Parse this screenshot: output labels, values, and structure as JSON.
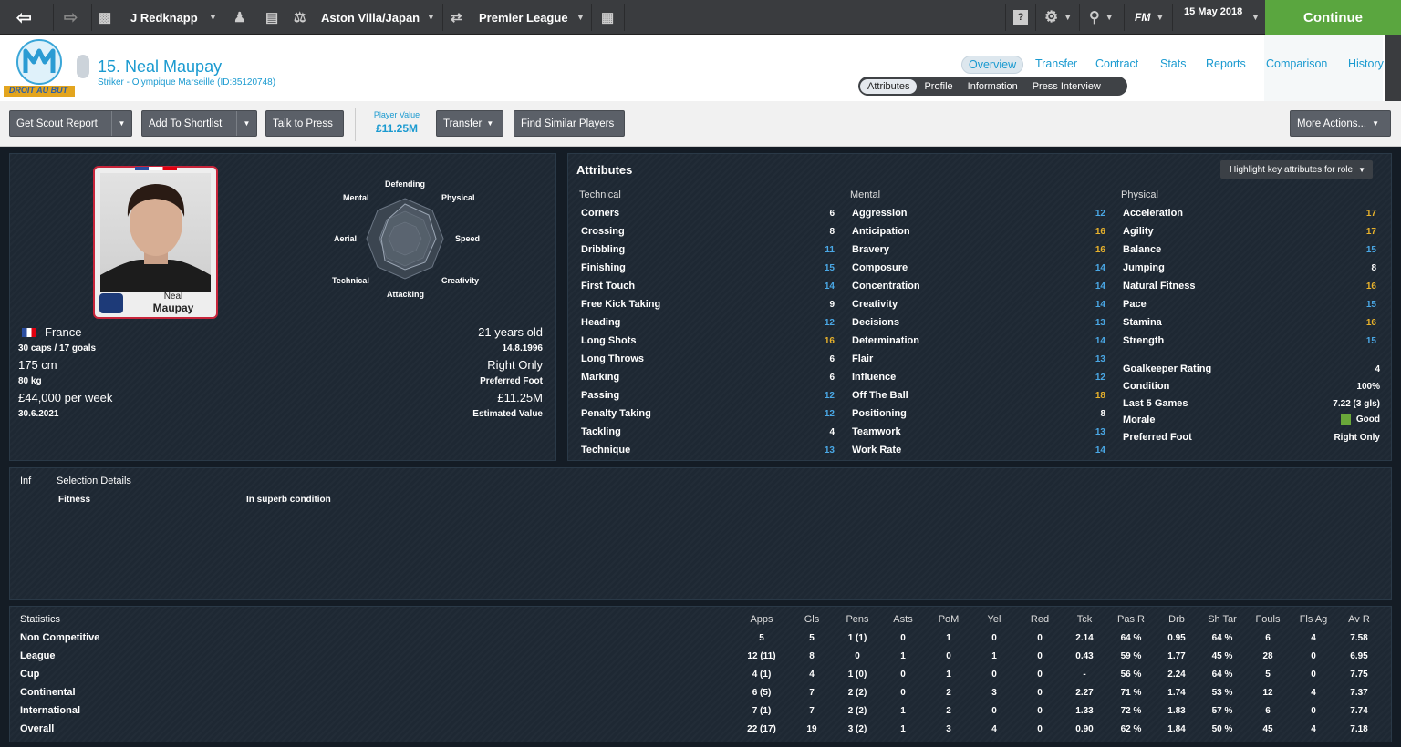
{
  "topbar": {
    "manager": "J Redknapp",
    "clubs": "Aston Villa/Japan",
    "league": "Premier League",
    "date": "15 May 2018",
    "fm_label": "FM",
    "continue": "Continue"
  },
  "header": {
    "crest_text": "DROIT AU BUT",
    "player_title": "15. Neal Maupay",
    "subtitle": "Striker - Olympique Marseille (ID:85120748)",
    "tabs": [
      "Overview",
      "Transfer",
      "Contract",
      "Stats",
      "Reports",
      "Comparison",
      "History"
    ],
    "subtabs": [
      "Attributes",
      "Profile",
      "Information",
      "Press Interview"
    ]
  },
  "toolbar": {
    "scout": "Get Scout Report",
    "shortlist": "Add To Shortlist",
    "press": "Talk to Press",
    "value_label": "Player Value",
    "value": "£11.25M",
    "transfer": "Transfer",
    "similar": "Find Similar Players",
    "more": "More Actions..."
  },
  "card": {
    "first": "Neal",
    "last": "Maupay"
  },
  "radar": {
    "labels": [
      "Defending",
      "Physical",
      "Speed",
      "Creativity",
      "Attacking",
      "Technical",
      "Aerial",
      "Mental"
    ]
  },
  "profile": {
    "nation": "France",
    "caps": "30 caps / 17 goals",
    "height": "175 cm",
    "weight": "80 kg",
    "wage": "£44,000 per week",
    "contract": "30.6.2021",
    "age": "21 years old",
    "dob": "14.8.1996",
    "foot": "Right Only",
    "foot_label": "Preferred Foot",
    "value": "£11.25M",
    "value_label": "Estimated Value"
  },
  "attributes": {
    "title": "Attributes",
    "highlight": "Highlight key attributes for role",
    "technical_title": "Technical",
    "mental_title": "Mental",
    "physical_title": "Physical",
    "technical": [
      {
        "n": "Corners",
        "v": "6",
        "c": "white"
      },
      {
        "n": "Crossing",
        "v": "8",
        "c": "white"
      },
      {
        "n": "Dribbling",
        "v": "11",
        "c": "blue"
      },
      {
        "n": "Finishing",
        "v": "15",
        "c": "blue"
      },
      {
        "n": "First Touch",
        "v": "14",
        "c": "blue"
      },
      {
        "n": "Free Kick Taking",
        "v": "9",
        "c": "white"
      },
      {
        "n": "Heading",
        "v": "12",
        "c": "blue"
      },
      {
        "n": "Long Shots",
        "v": "16",
        "c": "gold"
      },
      {
        "n": "Long Throws",
        "v": "6",
        "c": "white"
      },
      {
        "n": "Marking",
        "v": "6",
        "c": "white"
      },
      {
        "n": "Passing",
        "v": "12",
        "c": "blue"
      },
      {
        "n": "Penalty Taking",
        "v": "12",
        "c": "blue"
      },
      {
        "n": "Tackling",
        "v": "4",
        "c": "white"
      },
      {
        "n": "Technique",
        "v": "13",
        "c": "blue"
      }
    ],
    "mental": [
      {
        "n": "Aggression",
        "v": "12",
        "c": "blue"
      },
      {
        "n": "Anticipation",
        "v": "16",
        "c": "gold"
      },
      {
        "n": "Bravery",
        "v": "16",
        "c": "gold"
      },
      {
        "n": "Composure",
        "v": "14",
        "c": "blue"
      },
      {
        "n": "Concentration",
        "v": "14",
        "c": "blue"
      },
      {
        "n": "Creativity",
        "v": "14",
        "c": "blue"
      },
      {
        "n": "Decisions",
        "v": "13",
        "c": "blue"
      },
      {
        "n": "Determination",
        "v": "14",
        "c": "blue"
      },
      {
        "n": "Flair",
        "v": "13",
        "c": "blue"
      },
      {
        "n": "Influence",
        "v": "12",
        "c": "blue"
      },
      {
        "n": "Off The Ball",
        "v": "18",
        "c": "gold"
      },
      {
        "n": "Positioning",
        "v": "8",
        "c": "white"
      },
      {
        "n": "Teamwork",
        "v": "13",
        "c": "blue"
      },
      {
        "n": "Work Rate",
        "v": "14",
        "c": "blue"
      }
    ],
    "physical": [
      {
        "n": "Acceleration",
        "v": "17",
        "c": "gold"
      },
      {
        "n": "Agility",
        "v": "17",
        "c": "gold"
      },
      {
        "n": "Balance",
        "v": "15",
        "c": "blue"
      },
      {
        "n": "Jumping",
        "v": "8",
        "c": "white"
      },
      {
        "n": "Natural Fitness",
        "v": "16",
        "c": "gold"
      },
      {
        "n": "Pace",
        "v": "15",
        "c": "blue"
      },
      {
        "n": "Stamina",
        "v": "16",
        "c": "gold"
      },
      {
        "n": "Strength",
        "v": "15",
        "c": "blue"
      }
    ],
    "extra": [
      {
        "n": "Goalkeeper Rating",
        "v": "4"
      },
      {
        "n": "Condition",
        "v": "100%"
      },
      {
        "n": "Last 5 Games",
        "v": "7.22 (3 gls)"
      },
      {
        "n": "Morale",
        "v": "Good"
      },
      {
        "n": "Preferred Foot",
        "v": "Right Only"
      }
    ]
  },
  "selection": {
    "inf": "Inf",
    "title": "Selection Details",
    "label": "Fitness",
    "value": "In superb condition"
  },
  "stats": {
    "title": "Statistics",
    "headers": [
      "Apps",
      "Gls",
      "Pens",
      "Asts",
      "PoM",
      "Yel",
      "Red",
      "Tck",
      "Pas R",
      "Drb",
      "Sh Tar",
      "Fouls",
      "Fls Ag",
      "Av R"
    ],
    "rows": [
      {
        "label": "Non Competitive",
        "cells": [
          "5",
          "5",
          "1 (1)",
          "0",
          "1",
          "0",
          "0",
          "2.14",
          "64 %",
          "0.95",
          "64 %",
          "6",
          "4",
          "7.58"
        ]
      },
      {
        "label": "League",
        "cells": [
          "12 (11)",
          "8",
          "0",
          "1",
          "0",
          "1",
          "0",
          "0.43",
          "59 %",
          "1.77",
          "45 %",
          "28",
          "0",
          "6.95"
        ]
      },
      {
        "label": "Cup",
        "cells": [
          "4 (1)",
          "4",
          "1 (0)",
          "0",
          "1",
          "0",
          "0",
          "-",
          "56 %",
          "2.24",
          "64 %",
          "5",
          "0",
          "7.75"
        ]
      },
      {
        "label": "Continental",
        "cells": [
          "6 (5)",
          "7",
          "2 (2)",
          "0",
          "2",
          "3",
          "0",
          "2.27",
          "71 %",
          "1.74",
          "53 %",
          "12",
          "4",
          "7.37"
        ]
      },
      {
        "label": "International",
        "cells": [
          "7 (1)",
          "7",
          "2 (2)",
          "1",
          "2",
          "0",
          "0",
          "1.33",
          "72 %",
          "1.83",
          "57 %",
          "6",
          "0",
          "7.74"
        ]
      },
      {
        "label": "Overall",
        "cells": [
          "22 (17)",
          "19",
          "3 (2)",
          "1",
          "3",
          "4",
          "0",
          "0.90",
          "62 %",
          "1.84",
          "50 %",
          "45",
          "4",
          "7.18"
        ]
      }
    ]
  }
}
